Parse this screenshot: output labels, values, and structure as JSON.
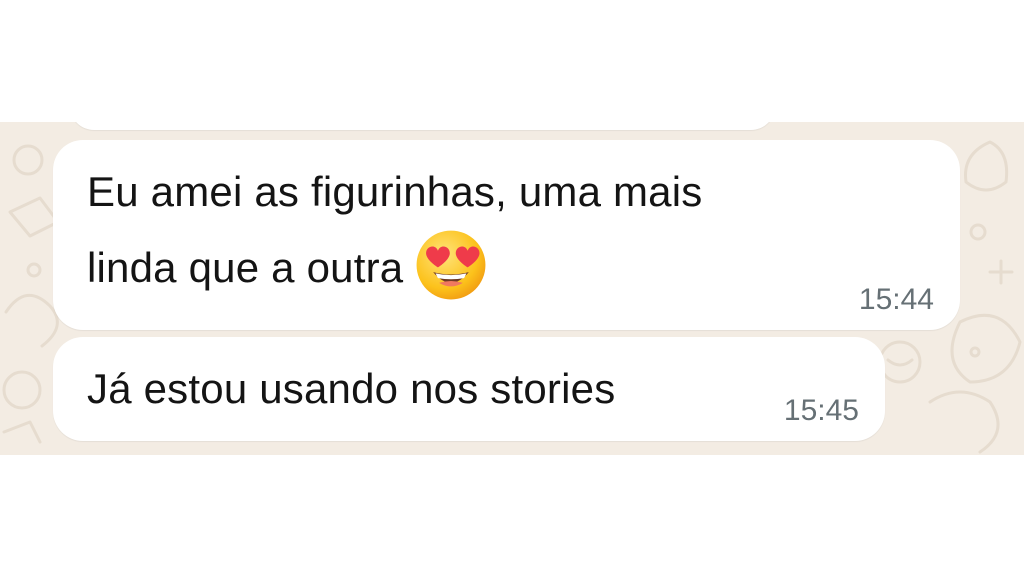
{
  "chat": {
    "background_color": "#f3ece3",
    "bubble_color": "#ffffff",
    "messages": [
      {
        "line1": "Eu amei as figurinhas, uma mais",
        "line2": "linda que a outra",
        "emoji": "smiling-face-with-heart-eyes",
        "time": "15:44"
      },
      {
        "text": "Já estou usando nos stories",
        "time": "15:45"
      }
    ]
  }
}
